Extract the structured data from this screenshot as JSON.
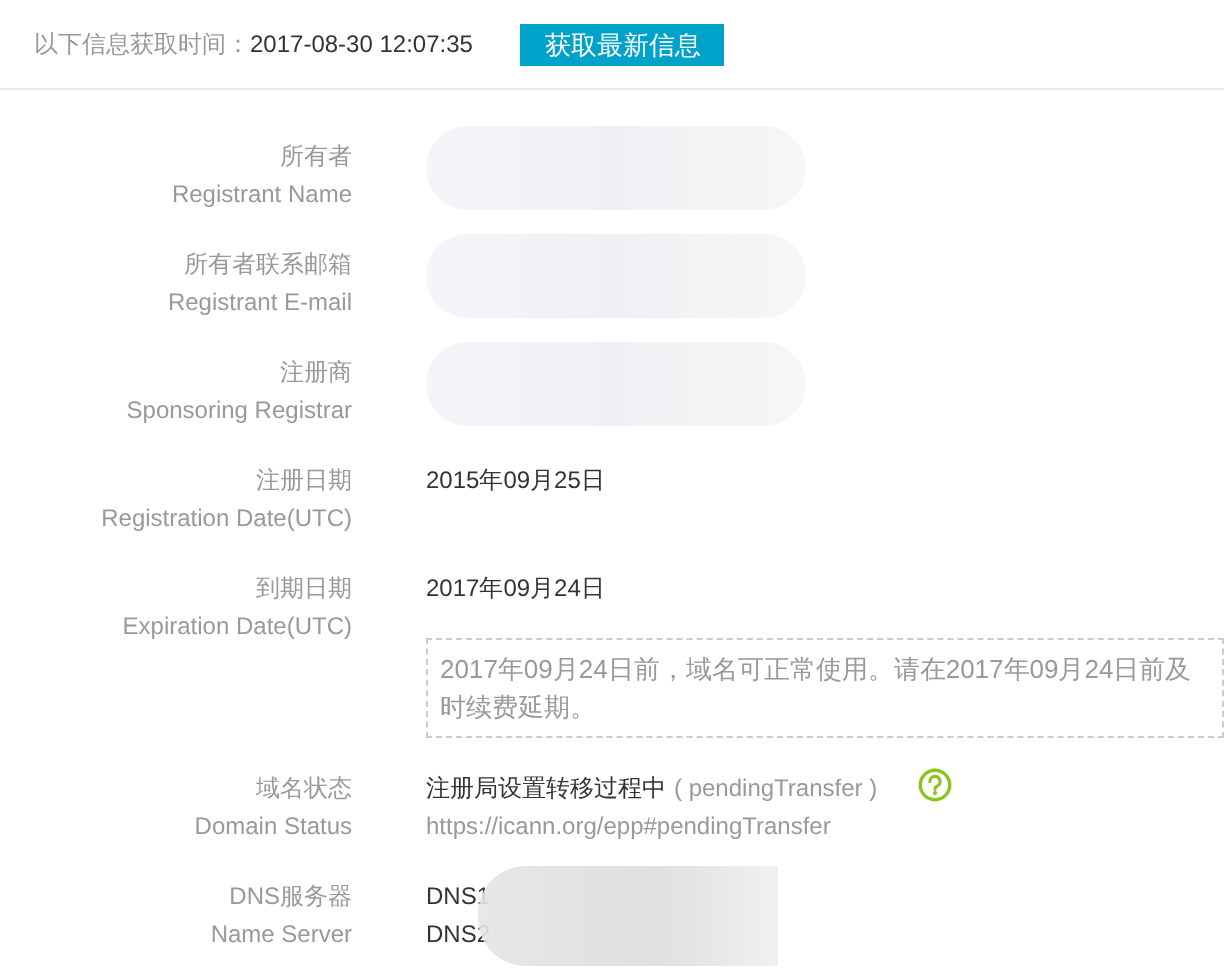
{
  "header": {
    "label": "以下信息获取时间：",
    "time": "2017-08-30 12:07:35",
    "button": "获取最新信息"
  },
  "rows": [
    {
      "kind": "redacted",
      "label_zh": "所有者",
      "label_en": "Registrant Name"
    },
    {
      "kind": "redacted",
      "label_zh": "所有者联系邮箱",
      "label_en": "Registrant E-mail"
    },
    {
      "kind": "redacted",
      "label_zh": "注册商",
      "label_en": "Sponsoring Registrar"
    },
    {
      "kind": "text",
      "label_zh": "注册日期",
      "label_en": "Registration Date(UTC)",
      "value": "2015年09月25日"
    },
    {
      "kind": "text",
      "label_zh": "到期日期",
      "label_en": "Expiration Date(UTC)",
      "value": "2017年09月24日",
      "note": "2017年09月24日前，域名可正常使用。请在2017年09月24日前及时续费延期。"
    },
    {
      "kind": "status",
      "label_zh": "域名状态",
      "label_en": "Domain Status",
      "value": "注册局设置转移过程中",
      "code": "( pendingTransfer )",
      "link": "https://icann.org/epp#pendingTransfer"
    },
    {
      "kind": "dns",
      "label_zh": "DNS服务器",
      "label_en": "Name Server",
      "values": [
        "DNS1",
        "DNS2"
      ]
    }
  ]
}
